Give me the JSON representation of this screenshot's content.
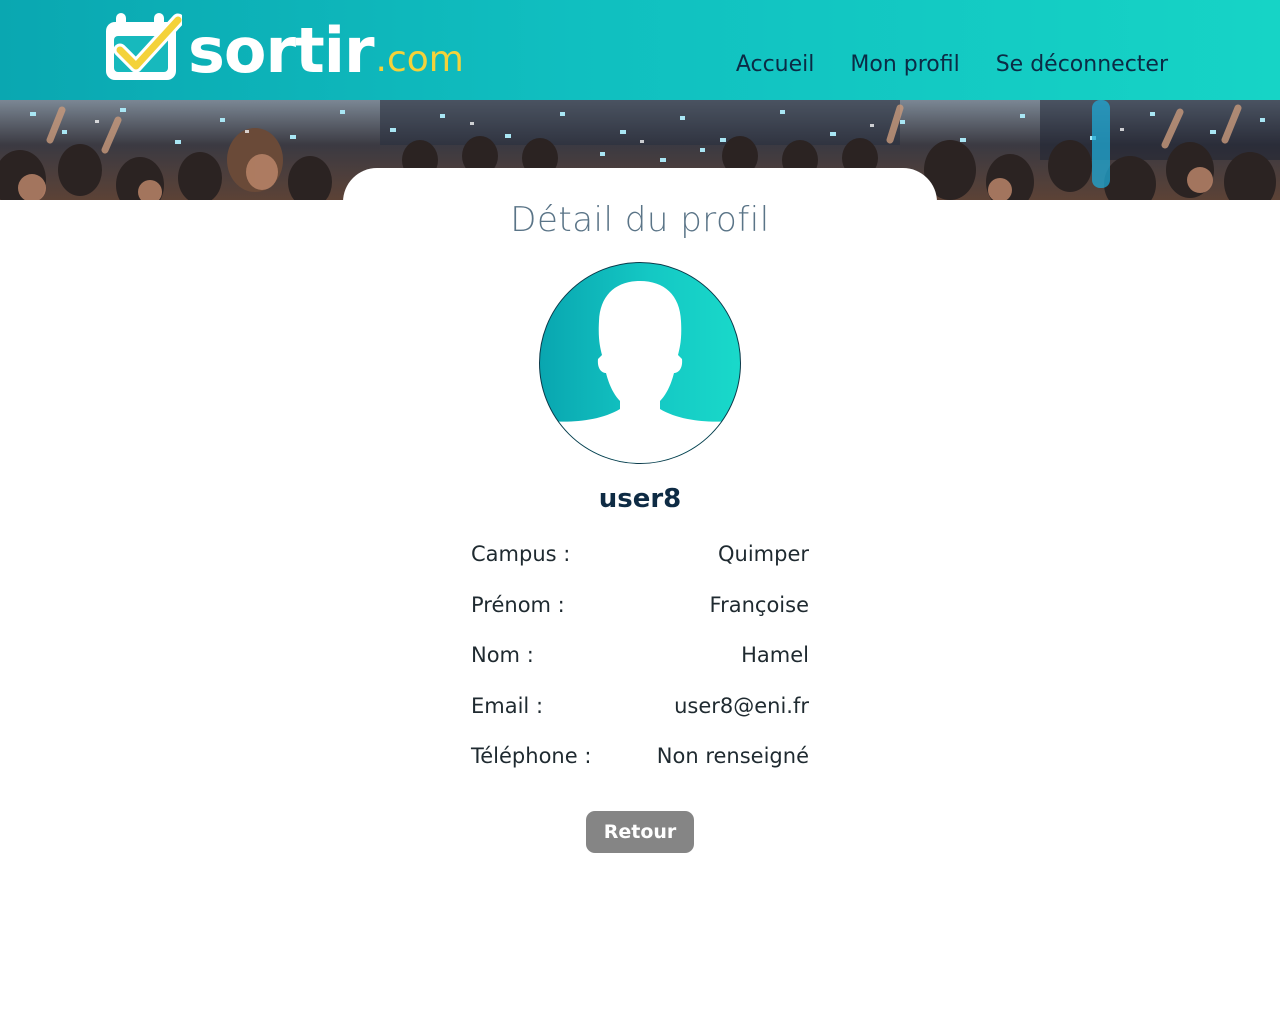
{
  "header": {
    "logo_main": "sortir",
    "logo_suffix": ".com",
    "nav": [
      {
        "label": "Accueil"
      },
      {
        "label": "Mon profil"
      },
      {
        "label": "Se déconnecter"
      }
    ]
  },
  "profile": {
    "title": "Détail du profil",
    "username": "user8",
    "fields": [
      {
        "label": "Campus :",
        "value": "Quimper"
      },
      {
        "label": "Prénom :",
        "value": "Françoise"
      },
      {
        "label": "Nom :",
        "value": "Hamel"
      },
      {
        "label": "Email :",
        "value": "user8@eni.fr"
      },
      {
        "label": "Téléphone :",
        "value": "Non renseigné"
      }
    ],
    "back_label": "Retour"
  },
  "icons": {
    "logo": "calendar-check-icon",
    "avatar": "user-silhouette-icon"
  },
  "colors": {
    "header_start": "#0aa7b1",
    "header_end": "#16d4c6",
    "logo_accent": "#f4d23a",
    "nav_text": "#0b2b45",
    "username": "#0e2b44",
    "button": "#858585"
  }
}
